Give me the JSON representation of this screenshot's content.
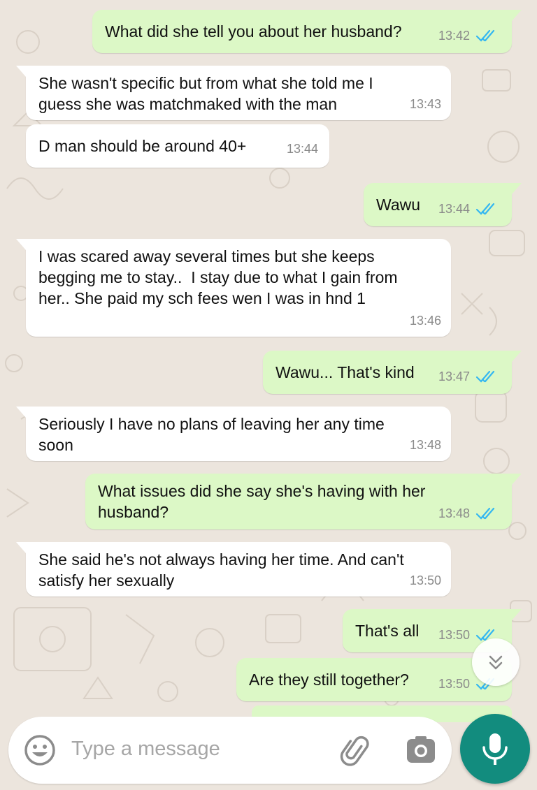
{
  "colors": {
    "chat_background": "#ece5dd",
    "incoming_bubble": "#ffffff",
    "outgoing_bubble": "#dcf8c6",
    "read_ticks": "#34b7f1",
    "mic_button": "#128c7e"
  },
  "messages": [
    {
      "direction": "outgoing",
      "text": "What did she tell you about her husband?",
      "time": "13:42",
      "status": "read"
    },
    {
      "direction": "incoming",
      "text": "She wasn't specific but from what she told me I\nguess she was matchmaked with the man",
      "time": "13:43"
    },
    {
      "direction": "incoming",
      "text": "D man should be around 40+",
      "time": "13:44"
    },
    {
      "direction": "outgoing",
      "text": "Wawu",
      "time": "13:44",
      "status": "read"
    },
    {
      "direction": "incoming",
      "text": "I was scared away several times but she keeps\nbegging me to stay..  I stay due to what I gain from\nher.. She paid my sch fees wen I was in hnd 1",
      "time": "13:46"
    },
    {
      "direction": "outgoing",
      "text": "Wawu... That's kind",
      "time": "13:47",
      "status": "read"
    },
    {
      "direction": "incoming",
      "text": "Seriously I have no plans of leaving her any time\nsoon",
      "time": "13:48"
    },
    {
      "direction": "outgoing",
      "text": "What issues did she say she's having with her\nhusband?",
      "time": "13:48",
      "status": "read"
    },
    {
      "direction": "incoming",
      "text": "She said he's not always having her time. And can't\nsatisfy her sexually",
      "time": "13:50"
    },
    {
      "direction": "outgoing",
      "text": "That's all",
      "time": "13:50",
      "status": "read"
    },
    {
      "direction": "outgoing",
      "text": "Are they still together?",
      "time": "13:50",
      "status": "read"
    }
  ],
  "composer": {
    "placeholder": "Type a message",
    "emoji_icon": "emoji-icon",
    "attach_icon": "paperclip-icon",
    "camera_icon": "camera-icon",
    "mic_icon": "mic-icon"
  },
  "scroll_button_icon": "double-chevron-down-icon"
}
